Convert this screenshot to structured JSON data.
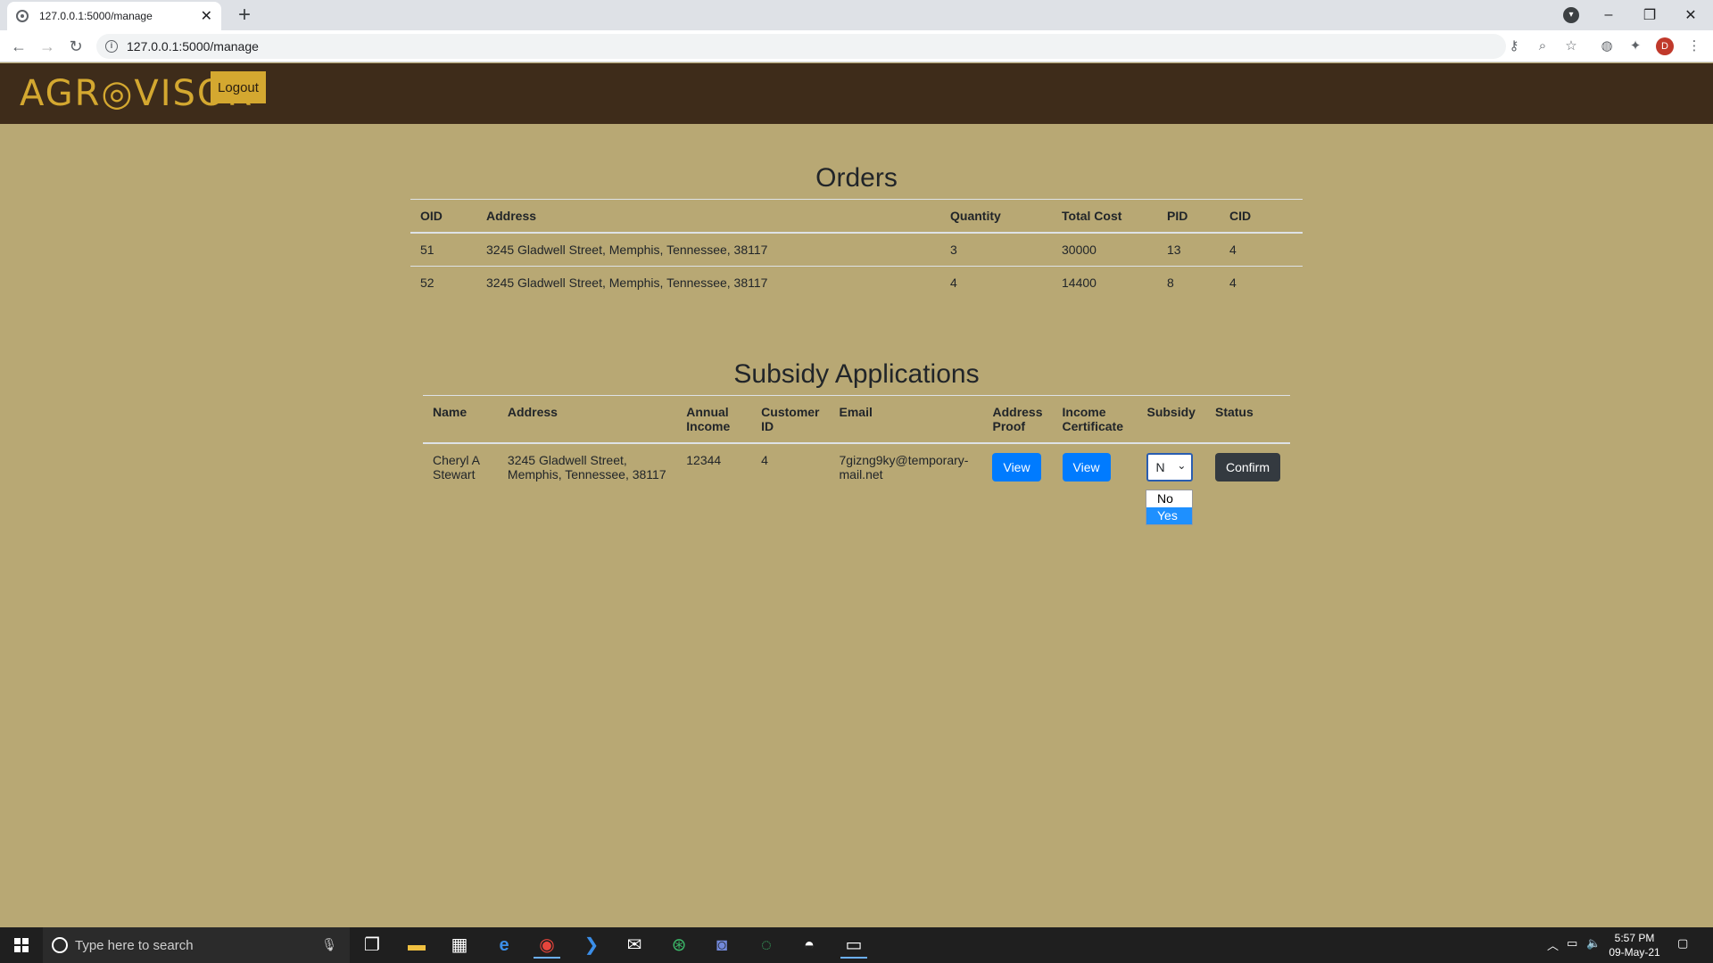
{
  "browser": {
    "tab_title": "127.0.0.1:5000/manage",
    "tab_close": "✕",
    "new_tab": "+",
    "url": "127.0.0.1:5000/manage",
    "profile_initial": "D"
  },
  "site": {
    "logo": "AGR◎VISOR",
    "logout_label": "Logout"
  },
  "orders": {
    "title": "Orders",
    "columns": [
      "OID",
      "Address",
      "Quantity",
      "Total Cost",
      "PID",
      "CID"
    ],
    "rows": [
      {
        "oid": "51",
        "address": "3245 Gladwell Street, Memphis, Tennessee, 38117",
        "quantity": "3",
        "total_cost": "30000",
        "pid": "13",
        "cid": "4"
      },
      {
        "oid": "52",
        "address": "3245 Gladwell Street, Memphis, Tennessee, 38117",
        "quantity": "4",
        "total_cost": "14400",
        "pid": "8",
        "cid": "4"
      }
    ]
  },
  "subsidy": {
    "title": "Subsidy Applications",
    "columns": {
      "name": "Name",
      "address": "Address",
      "annual_income": "Annual Income",
      "customer_id": "Customer ID",
      "email": "Email",
      "address_proof": "Address Proof",
      "income_certificate": "Income Certificate",
      "subsidy": "Subsidy",
      "status": "Status"
    },
    "row": {
      "name": "Cheryl A Stewart",
      "address": "3245 Gladwell Street, Memphis, Tennessee, 38117",
      "annual_income": "12344",
      "customer_id": "4",
      "email": "7gizng9ky@temporary-mail.net",
      "address_proof_btn": "View",
      "income_certificate_btn": "View",
      "subsidy_selected": "N",
      "confirm_btn": "Confirm"
    },
    "dropdown_options": [
      "No",
      "Yes"
    ],
    "dropdown_highlighted": "Yes"
  },
  "taskbar": {
    "search_placeholder": "Type here to search",
    "time": "5:57 PM",
    "date": "09-May-21"
  },
  "colors": {
    "page_bg": "#b8a874",
    "header_bg": "#3e2c1a",
    "accent_gold": "#d4a830",
    "primary_blue": "#007bff",
    "dark_button": "#343a40"
  }
}
